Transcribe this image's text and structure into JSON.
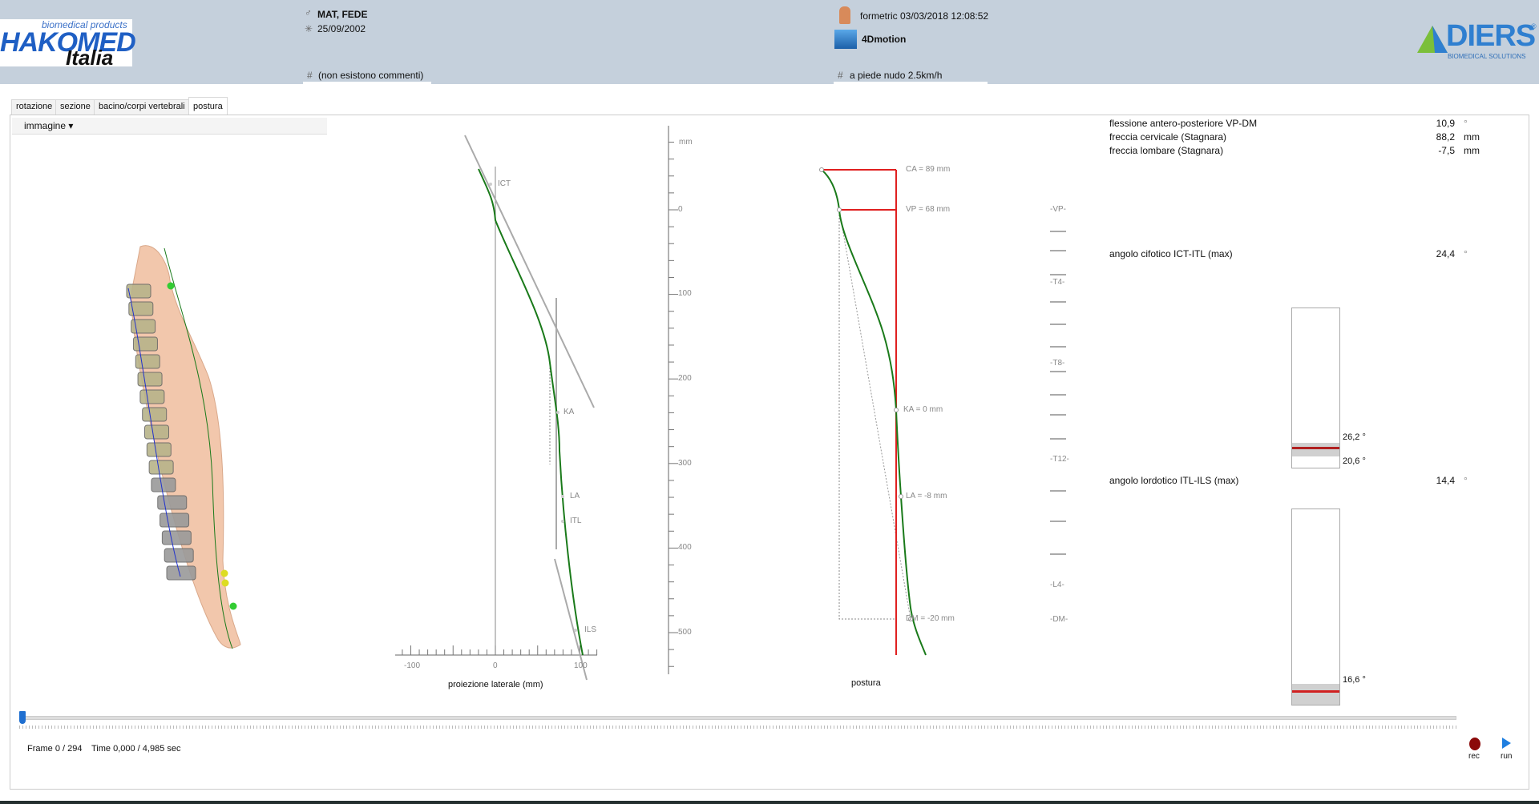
{
  "header": {
    "logo_left": {
      "small": "biomedical products",
      "big": "HAKOMED",
      "sub": "Italia"
    },
    "patient_name": "MAT, FEDE",
    "patient_gender_icon": "male-icon",
    "birth_date": "25/09/2002",
    "comment": "(non esistono commenti)",
    "comment_prefix": "#",
    "exam": "formetric 03/03/2018 12:08:52",
    "mode": "4Dmotion",
    "condition": "a piede nudo 2.5km/h",
    "condition_prefix": "#",
    "logo_right": {
      "big": "DIERS",
      "reg": "®",
      "sub": "BIOMEDICAL SOLUTIONS"
    }
  },
  "tabs": [
    "rotazione",
    "sezione",
    "bacino/corpi vertebrali",
    "postura"
  ],
  "active_tab": 3,
  "toolbar": {
    "dropdown": "immagine ▾"
  },
  "lateral": {
    "xlabel": "proiezione laterale (mm)",
    "xticks": [
      "-100",
      "0",
      "100"
    ],
    "landmarks": [
      "ICT",
      "KA",
      "LA",
      "ITL",
      "ILS"
    ]
  },
  "scale": {
    "unit": "mm",
    "ticks": [
      "0",
      "100",
      "200",
      "300",
      "400",
      "500"
    ]
  },
  "postura": {
    "title": "postura",
    "labels": [
      "CA = 89 mm",
      "VP = 68 mm",
      "KA = 0 mm",
      "LA = -8 mm",
      "DM = -20 mm"
    ]
  },
  "vertebrae": [
    "-VP-",
    "-T4-",
    "-T8-",
    "-T12-",
    "-L4-",
    "-DM-"
  ],
  "measures": [
    {
      "label": "flessione antero-posteriore VP-DM",
      "value": "10,9",
      "unit": "°"
    },
    {
      "label": "freccia cervicale (Stagnara)",
      "value": "88,2",
      "unit": "mm"
    },
    {
      "label": "freccia lombare (Stagnara)",
      "value": "-7,5",
      "unit": "mm"
    },
    {
      "label": "angolo cifotico ICT-ITL (max)",
      "value": "24,4",
      "unit": "°"
    },
    {
      "label": "angolo lordotico ITL-ILS (max)",
      "value": "14,4",
      "unit": "°"
    }
  ],
  "gauges": [
    {
      "upper": "26,2 °",
      "lower": "20,6 °"
    },
    {
      "upper": "16,6 °"
    }
  ],
  "player": {
    "frame": "Frame 0 / 294",
    "time": "Time 0,000 / 4,985 sec",
    "rec": "rec",
    "run": "run",
    "progress": 0
  },
  "colors": {
    "header": "#c5d0dc",
    "curve": "#1a7a1a",
    "red": "#e02020",
    "accent": "#1f6fd0"
  }
}
